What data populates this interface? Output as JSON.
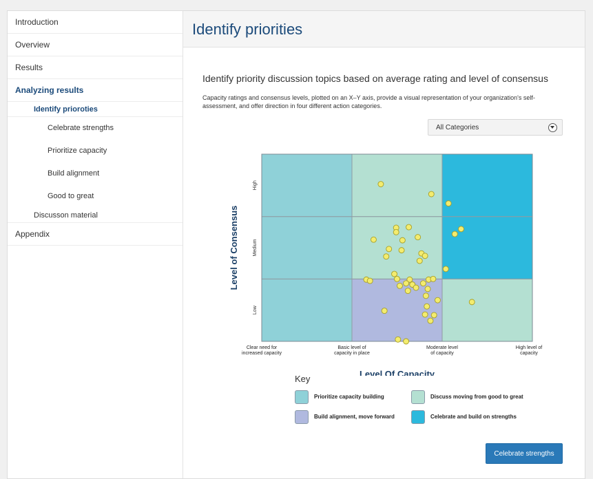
{
  "sidebar": {
    "items": [
      {
        "label": "Introduction"
      },
      {
        "label": "Overview"
      },
      {
        "label": "Results"
      },
      {
        "label": "Analyzing results"
      },
      {
        "label": "Identify prioroties"
      },
      {
        "label": "Celebrate strengths"
      },
      {
        "label": "Prioritize capacity"
      },
      {
        "label": "Build alignment"
      },
      {
        "label": "Good to great"
      },
      {
        "label": "Discusson material"
      },
      {
        "label": "Appendix"
      }
    ]
  },
  "page": {
    "title": "Identify priorities",
    "section_title": "Identify priority discussion topics based on average rating and level of consensus",
    "description": "Capacity ratings and consensus levels, plotted on an X–Y axis, provide a visual representation of your organization's self-assessment, and offer direction in four different action categories."
  },
  "dropdown": {
    "selected": "All Categories"
  },
  "button": {
    "label": "Celebrate strengths"
  },
  "colors": {
    "prioritize": "#8fd1d8",
    "discuss": "#b4e0d2",
    "alignment": "#b0b9df",
    "celebrate": "#2cb9dd",
    "point": "#f3ec6f"
  },
  "chart_data": {
    "type": "scatter",
    "xlabel": "Level Of Capacity",
    "ylabel": "Level of Consensus",
    "xlim": [
      0,
      3
    ],
    "ylim": [
      0,
      3
    ],
    "x_ticks": [
      "Clear need for increased capacity",
      "Basic level of capacity in place",
      "Moderate level of capacity",
      "High level of capacity"
    ],
    "y_ticks": [
      "Low",
      "Medium",
      "High"
    ],
    "cells": [
      [
        "prioritize",
        "alignment",
        "discuss"
      ],
      [
        "prioritize",
        "discuss",
        "celebrate"
      ],
      [
        "prioritize",
        "discuss",
        "celebrate"
      ]
    ],
    "legend_title": "Key",
    "legend": [
      {
        "label": "Prioritize capacity building",
        "key": "prioritize"
      },
      {
        "label": "Discuss moving from good to great",
        "key": "discuss"
      },
      {
        "label": "Build alignment, move forward",
        "key": "alignment"
      },
      {
        "label": "Celebrate and build on strengths",
        "key": "celebrate"
      }
    ],
    "points": [
      [
        1.32,
        2.52
      ],
      [
        1.88,
        2.36
      ],
      [
        2.07,
        2.21
      ],
      [
        1.49,
        1.82
      ],
      [
        1.49,
        1.75
      ],
      [
        1.63,
        1.83
      ],
      [
        1.73,
        1.67
      ],
      [
        2.21,
        1.8
      ],
      [
        2.14,
        1.72
      ],
      [
        1.24,
        1.63
      ],
      [
        1.56,
        1.62
      ],
      [
        1.55,
        1.46
      ],
      [
        1.41,
        1.48
      ],
      [
        1.77,
        1.41
      ],
      [
        1.81,
        1.37
      ],
      [
        1.75,
        1.29
      ],
      [
        1.38,
        1.36
      ],
      [
        2.04,
        1.16
      ],
      [
        1.47,
        1.08
      ],
      [
        1.5,
        1.0
      ],
      [
        1.64,
        0.99
      ],
      [
        1.85,
        0.99
      ],
      [
        1.9,
        1.0
      ],
      [
        1.16,
        0.99
      ],
      [
        1.2,
        0.97
      ],
      [
        1.6,
        0.93
      ],
      [
        1.67,
        0.91
      ],
      [
        1.79,
        0.93
      ],
      [
        1.71,
        0.86
      ],
      [
        1.84,
        0.84
      ],
      [
        1.53,
        0.89
      ],
      [
        1.62,
        0.81
      ],
      [
        1.82,
        0.73
      ],
      [
        1.95,
        0.66
      ],
      [
        2.33,
        0.63
      ],
      [
        1.83,
        0.56
      ],
      [
        1.36,
        0.49
      ],
      [
        1.81,
        0.43
      ],
      [
        1.91,
        0.42
      ],
      [
        1.87,
        0.33
      ],
      [
        1.51,
        0.03
      ],
      [
        1.6,
        0.0
      ]
    ]
  }
}
